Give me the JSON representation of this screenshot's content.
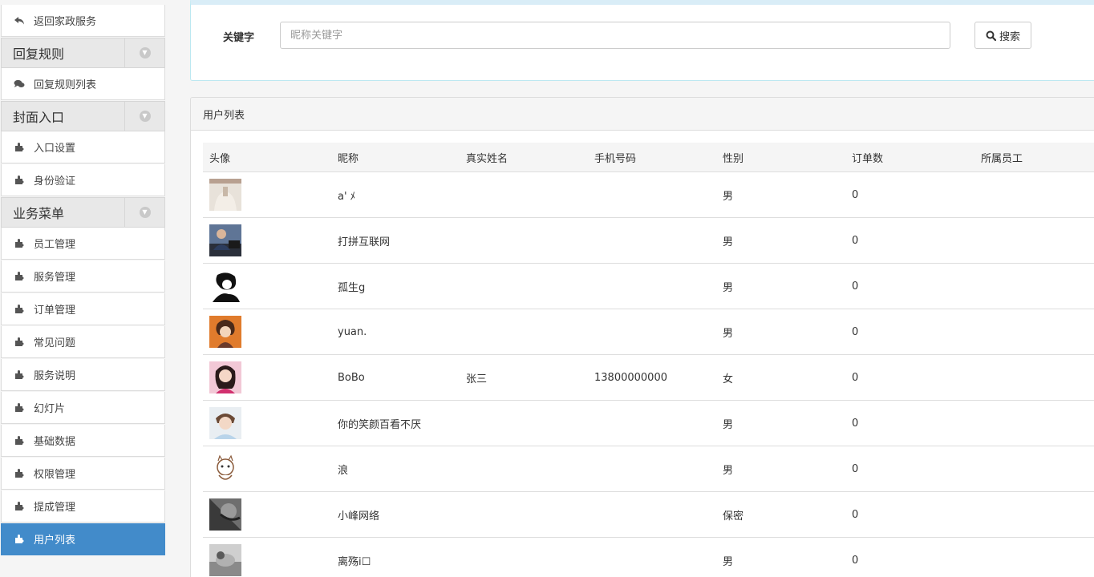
{
  "sidebar": {
    "back_link": "返回家政服务",
    "group_reply": "回复规则",
    "reply_list": "回复规则列表",
    "group_cover": "封面入口",
    "entry_settings": "入口设置",
    "identity_verify": "身份验证",
    "group_business": "业务菜单",
    "items": [
      "员工管理",
      "服务管理",
      "订单管理",
      "常见问题",
      "服务说明",
      "幻灯片",
      "基础数据",
      "权限管理",
      "提成管理",
      "用户列表"
    ],
    "active_item": "用户列表",
    "active_color": "#428bca"
  },
  "search": {
    "keyword_label": "关键字",
    "placeholder": "昵称关键字",
    "value": "",
    "button_label": "搜索"
  },
  "list": {
    "panel_title": "用户列表",
    "columns": [
      "头像",
      "昵称",
      "真实姓名",
      "手机号码",
      "性别",
      "订单数",
      "所属员工"
    ],
    "rows": [
      {
        "avatar": "avatar-1",
        "nickname": "a' ﾒ",
        "real_name": "",
        "phone": "",
        "gender": "男",
        "orders": "0",
        "staff": ""
      },
      {
        "avatar": "avatar-2",
        "nickname": "打拼互联网",
        "real_name": "",
        "phone": "",
        "gender": "男",
        "orders": "0",
        "staff": ""
      },
      {
        "avatar": "avatar-3",
        "nickname": "孤生g",
        "real_name": "",
        "phone": "",
        "gender": "男",
        "orders": "0",
        "staff": ""
      },
      {
        "avatar": "avatar-4",
        "nickname": "yuan.",
        "real_name": "",
        "phone": "",
        "gender": "男",
        "orders": "0",
        "staff": ""
      },
      {
        "avatar": "avatar-5",
        "nickname": "BoBo",
        "real_name": "张三",
        "phone": "13800000000",
        "gender": "女",
        "orders": "0",
        "staff": ""
      },
      {
        "avatar": "avatar-6",
        "nickname": "你的笑颜百看不厌",
        "real_name": "",
        "phone": "",
        "gender": "男",
        "orders": "0",
        "staff": ""
      },
      {
        "avatar": "avatar-7",
        "nickname": "浪",
        "real_name": "",
        "phone": "",
        "gender": "男",
        "orders": "0",
        "staff": ""
      },
      {
        "avatar": "avatar-8",
        "nickname": "小峰网络",
        "real_name": "",
        "phone": "",
        "gender": "保密",
        "orders": "0",
        "staff": ""
      },
      {
        "avatar": "avatar-9",
        "nickname": "离殇i☐",
        "real_name": "",
        "phone": "",
        "gender": "男",
        "orders": "0",
        "staff": ""
      }
    ]
  },
  "icons": {
    "back": "reply-arrow-icon",
    "comments": "comments-icon",
    "puzzle": "puzzle-piece-icon",
    "chevron": "chevron-down-circle-icon",
    "search": "search-icon"
  }
}
